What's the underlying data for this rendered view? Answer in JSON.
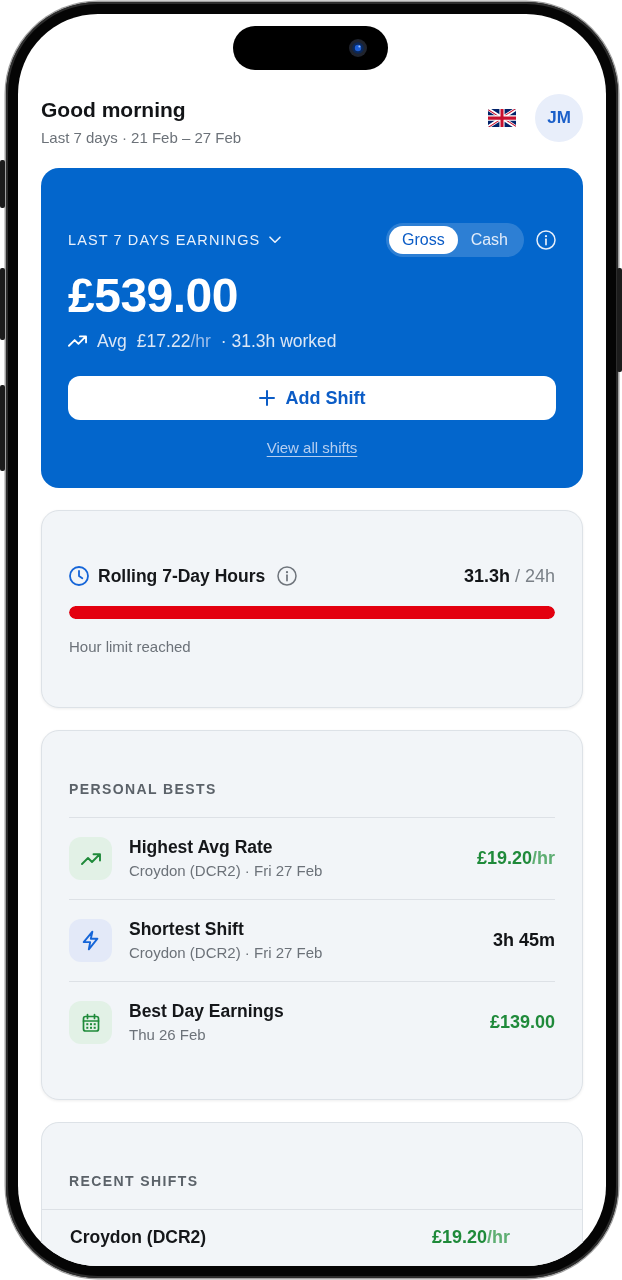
{
  "header": {
    "greeting": "Good morning",
    "subtitle": "Last 7 days · 21 Feb – 27 Feb",
    "avatar_initials": "JM"
  },
  "earnings": {
    "period_label": "LAST 7 DAYS EARNINGS",
    "toggle": [
      {
        "label": "Gross",
        "selected": true
      },
      {
        "label": "Cash",
        "selected": false
      }
    ],
    "amount": "£539.00",
    "avg_label": "Avg",
    "avg_rate": "£17.22",
    "avg_unit": "/hr",
    "hours_worked": "· 31.3h worked",
    "add_button": "Add Shift",
    "link": "View all shifts"
  },
  "hours": {
    "title": "Rolling 7-Day Hours",
    "used": "31.3h",
    "limit": "/ 24h",
    "level": 1,
    "over_limit": true,
    "status": "Hour limit reached"
  },
  "personal_bests": {
    "title": "PERSONAL BESTS",
    "items": [
      {
        "kind": "rate",
        "title": "Highest Avg Rate",
        "details": "Croydon (DCR2) · Fri 27 Feb",
        "value": "£19.20",
        "unit": "/hr"
      },
      {
        "kind": "duration",
        "title": "Shortest Shift",
        "details": "Croydon (DCR2) · Fri 27 Feb",
        "value": "3h 45m"
      },
      {
        "kind": "earnings",
        "title": "Best Day Earnings",
        "details": "Thu 26 Feb",
        "value": "£139.00"
      }
    ]
  },
  "recent_shifts": {
    "title": "RECENT SHIFTS",
    "rows": [
      {
        "site": "Croydon (DCR2)",
        "value": "£19.20",
        "unit": "/hr"
      }
    ]
  }
}
